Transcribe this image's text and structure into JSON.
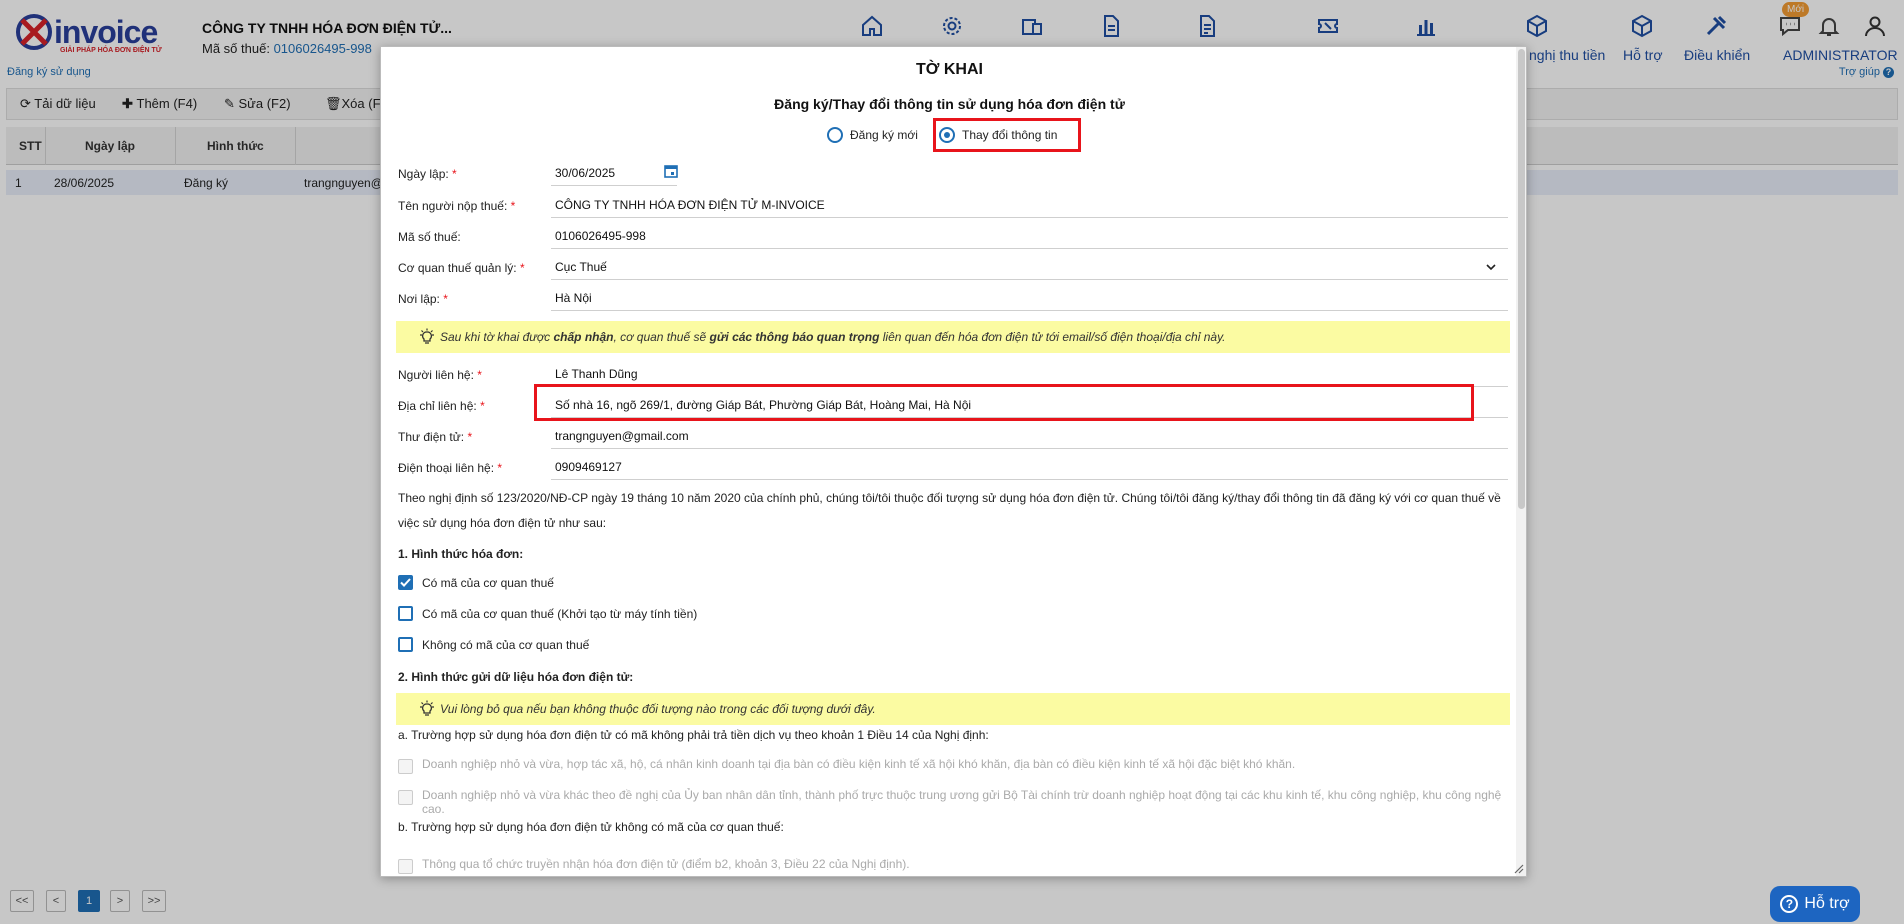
{
  "app": {
    "logo_text": "invoice",
    "logo_tagline": "GIẢI PHÁP HÓA ĐƠN ĐIỆN TỬ",
    "company_name": "CÔNG TY TNHH HÓA ĐƠN ĐIỆN TỬ...",
    "tax_label": "Mã số thuế:",
    "tax_value": "0106026495-998",
    "register_link": "Đăng ký sử dụng",
    "help_link": "Trợ giúp",
    "new_badge": "Mới",
    "nav": {
      "may_tinh_tien": "nghị thu tiền",
      "ho_tro": "Hỗ trợ",
      "dieu_khien": "Điều khiển",
      "user": "ADMINISTRATOR"
    }
  },
  "toolbar": {
    "reload": "Tải dữ liệu",
    "add": "Thêm (F4)",
    "edit": "Sửa (F2)",
    "delete": "Xóa (F"
  },
  "grid": {
    "headers": [
      "STT",
      "Ngày lập",
      "Hình thức"
    ],
    "rows": [
      [
        "1",
        "28/06/2025",
        "Đăng ký",
        "trangnguyen@"
      ]
    ]
  },
  "pager": {
    "first": "<<",
    "prev": "<",
    "page": "1",
    "next": ">",
    "last": ">>"
  },
  "help_button": "Hỗ trợ",
  "modal": {
    "title": "TỜ KHAI",
    "subtitle": "Đăng ký/Thay đổi thông tin sử dụng hóa đơn điện tử",
    "radio_new": "Đăng ký mới",
    "radio_change": "Thay đổi thông tin",
    "fields": {
      "ngay_lap": {
        "label": "Ngày lập:",
        "value": "30/06/2025"
      },
      "ten_nnt": {
        "label": "Tên người nộp thuế:",
        "value": "CÔNG TY TNHH HÓA ĐƠN ĐIỆN TỬ M-INVOICE"
      },
      "mst": {
        "label": "Mã số thuế:",
        "value": "0106026495-998"
      },
      "cqt": {
        "label": "Cơ quan thuế quản lý:",
        "value": "Cục Thuế"
      },
      "noi_lap": {
        "label": "Nơi lập:",
        "value": "Hà Nội"
      },
      "nguoi_lh": {
        "label": "Người liên hệ:",
        "value": "Lê Thanh Dũng"
      },
      "dia_chi": {
        "label": "Địa chỉ liên hệ:",
        "value": "Số nhà 16, ngõ 269/1, đường Giáp Bát, Phường Giáp Bát, Hoàng Mai, Hà Nội"
      },
      "email": {
        "label": "Thư điện tử:",
        "value": "trangnguyen@gmail.com"
      },
      "phone": {
        "label": "Điện thoại liên hệ:",
        "value": "0909469127"
      }
    },
    "tip1": {
      "pre": "Sau khi tờ khai được ",
      "b1": "chấp nhận",
      "mid": ", cơ quan thuế sẽ ",
      "b2": "gửi các thông báo quan trọng",
      "post": " liên quan đến hóa đơn điện tử tới email/số điện thoại/địa chỉ này."
    },
    "paragraph": "Theo nghị định số 123/2020/NĐ-CP ngày 19 tháng 10 năm 2020 của chính phủ, chúng tôi/tôi thuộc đối tượng sử dụng hóa đơn điện tử. Chúng tôi/tôi đăng ký/thay đổi thông tin đã đăng ký với cơ quan thuế về việc sử dụng hóa đơn điện tử như sau:",
    "section1": "1. Hình thức hóa đơn:",
    "cb1": "Có mã của cơ quan thuế",
    "cb2": "Có mã của cơ quan thuế (Khởi tạo từ máy tính tiền)",
    "cb3": "Không có mã của cơ quan thuế",
    "section2": "2. Hình thức gửi dữ liệu hóa đơn điện tử:",
    "tip2": "Vui lòng bỏ qua nếu bạn không thuộc đối tượng nào trong các đối tượng dưới đây.",
    "case_a": "a. Trường hợp sử dụng hóa đơn điện tử có mã không phải trả tiền dịch vụ theo khoản 1 Điều 14 của Nghị định:",
    "case_a1": "Doanh nghiệp nhỏ và vừa, hợp tác xã, hộ, cá nhân kinh doanh tại địa bàn có điều kiện kinh tế xã hội khó khăn, địa bàn có điều kiện kinh tế xã hội đặc biệt khó khăn.",
    "case_a2": "Doanh nghiệp nhỏ và vừa khác theo đề nghị của Ủy ban nhân dân tỉnh, thành phố trực thuộc trung ương gửi Bộ Tài chính trừ doanh nghiệp hoạt động tại các khu kinh tế, khu công nghiệp, khu công nghệ cao.",
    "case_b": "b. Trường hợp sử dụng hóa đơn điện tử không có mã của cơ quan thuế:",
    "case_b1": "Thông qua tổ chức truyền nhận hóa đơn điện tử (điểm b2, khoản 3, Điều 22 của Nghị định)."
  },
  "colors": {
    "accent": "#1f6fb5",
    "highlight": "#e8141b",
    "tip_bg": "#fbfba2",
    "brand": "#2a3f9b"
  }
}
